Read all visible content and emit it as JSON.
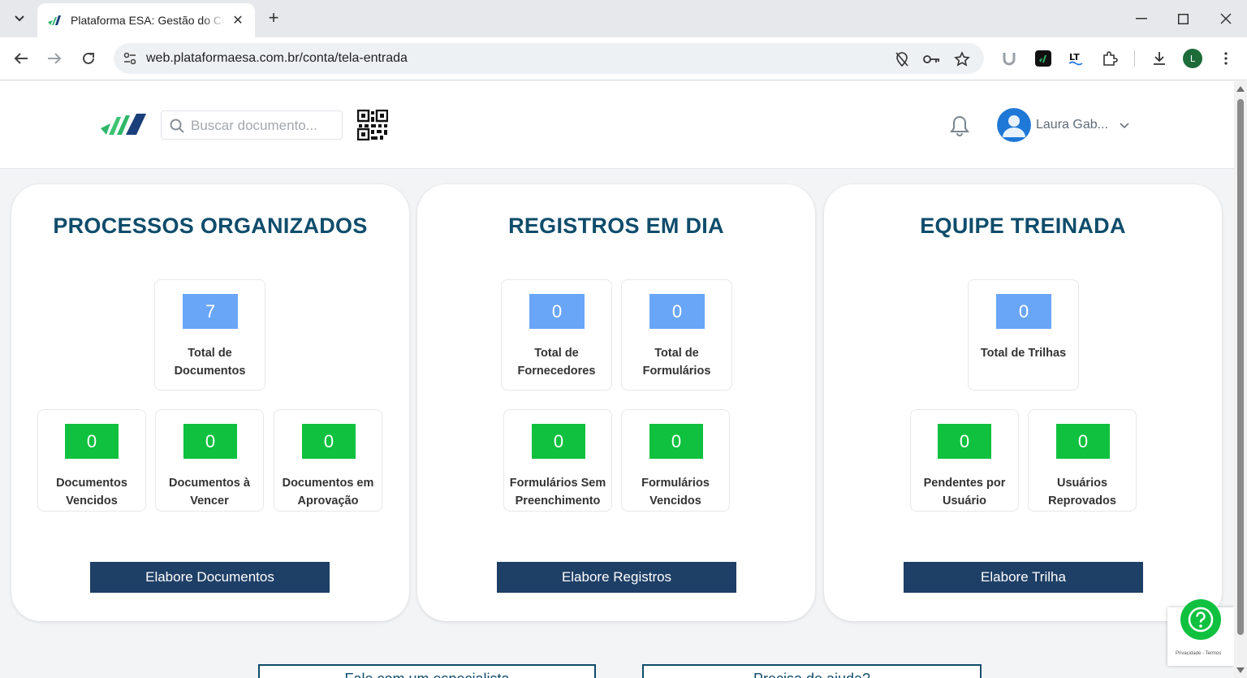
{
  "browser": {
    "tab_title": "Plataforma ESA: Gestão do Conhecimento",
    "url": "web.plataformaesa.com.br/conta/tela-entrada",
    "profile_initial": "L"
  },
  "header": {
    "search_placeholder": "Buscar documento...",
    "user_name": "Laura Gab..."
  },
  "cards": [
    {
      "title": "PROCESSOS ORGANIZADOS",
      "top_stats": [
        {
          "value": "7",
          "label": "Total de Documentos"
        }
      ],
      "bottom_stats": [
        {
          "value": "0",
          "label": "Documentos Vencidos"
        },
        {
          "value": "0",
          "label": "Documentos à Vencer"
        },
        {
          "value": "0",
          "label": "Documentos em Aprovação"
        }
      ],
      "button": "Elabore Documentos"
    },
    {
      "title": "REGISTROS EM DIA",
      "top_stats": [
        {
          "value": "0",
          "label": "Total de Fornecedores"
        },
        {
          "value": "0",
          "label": "Total de Formulários"
        }
      ],
      "bottom_stats": [
        {
          "value": "0",
          "label": "Formulários Sem Preenchimento"
        },
        {
          "value": "0",
          "label": "Formulários Vencidos"
        }
      ],
      "button": "Elabore Registros"
    },
    {
      "title": "EQUIPE TREINADA",
      "top_stats": [
        {
          "value": "0",
          "label": "Total de Trilhas"
        }
      ],
      "bottom_stats": [
        {
          "value": "0",
          "label": "Pendentes por Usuário"
        },
        {
          "value": "0",
          "label": "Usuários Reprovados"
        }
      ],
      "button": "Elabore Trilha"
    }
  ],
  "bottom_buttons": [
    "Fale com um especialista",
    "Precisa de ajuda?"
  ],
  "help": {
    "privacy": "Privacidade - Termos"
  },
  "colors": {
    "brand_title": "#0f4c6b",
    "cta": "#1e3f66",
    "stat_blue": "#6aa6f8",
    "stat_green": "#10c13f"
  }
}
